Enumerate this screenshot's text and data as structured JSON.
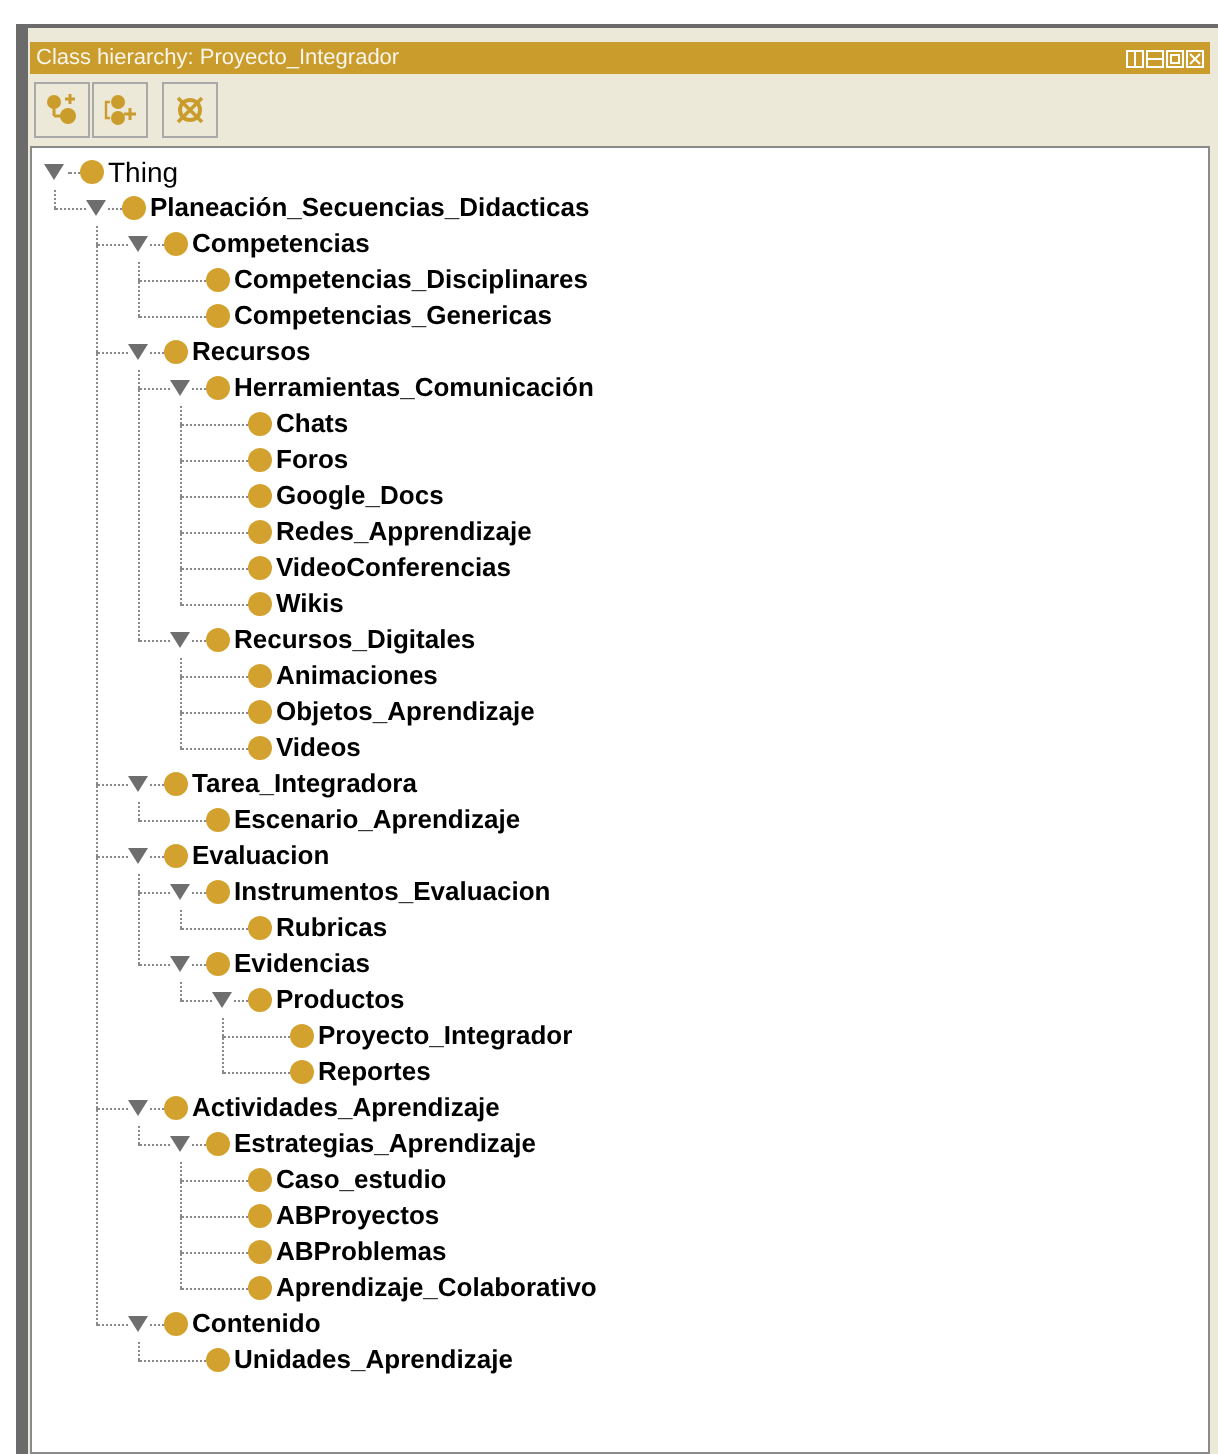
{
  "panel": {
    "title": "Class hierarchy: Proyecto_Integrador"
  },
  "tree": [
    {
      "label": "Thing",
      "bold": false,
      "expanded": true,
      "children": [
        {
          "label": "Planeación_Secuencias_Didacticas",
          "bold": true,
          "expanded": true,
          "children": [
            {
              "label": "Competencias",
              "bold": true,
              "expanded": true,
              "children": [
                {
                  "label": "Competencias_Disciplinares",
                  "bold": true
                },
                {
                  "label": "Competencias_Genericas",
                  "bold": true
                }
              ]
            },
            {
              "label": "Recursos",
              "bold": true,
              "expanded": true,
              "children": [
                {
                  "label": "Herramientas_Comunicación",
                  "bold": true,
                  "expanded": true,
                  "children": [
                    {
                      "label": "Chats",
                      "bold": true
                    },
                    {
                      "label": "Foros",
                      "bold": true
                    },
                    {
                      "label": "Google_Docs",
                      "bold": true
                    },
                    {
                      "label": "Redes_Apprendizaje",
                      "bold": true
                    },
                    {
                      "label": "VideoConferencias",
                      "bold": true
                    },
                    {
                      "label": "Wikis",
                      "bold": true
                    }
                  ]
                },
                {
                  "label": "Recursos_Digitales",
                  "bold": true,
                  "expanded": true,
                  "children": [
                    {
                      "label": "Animaciones",
                      "bold": true
                    },
                    {
                      "label": "Objetos_Aprendizaje",
                      "bold": true
                    },
                    {
                      "label": "Videos",
                      "bold": true
                    }
                  ]
                }
              ]
            },
            {
              "label": "Tarea_Integradora",
              "bold": true,
              "expanded": true,
              "children": [
                {
                  "label": "Escenario_Aprendizaje",
                  "bold": true
                }
              ]
            },
            {
              "label": "Evaluacion",
              "bold": true,
              "expanded": true,
              "children": [
                {
                  "label": "Instrumentos_Evaluacion",
                  "bold": true,
                  "expanded": true,
                  "children": [
                    {
                      "label": "Rubricas",
                      "bold": true
                    }
                  ]
                },
                {
                  "label": "Evidencias",
                  "bold": true,
                  "expanded": true,
                  "children": [
                    {
                      "label": "Productos",
                      "bold": true,
                      "expanded": true,
                      "children": [
                        {
                          "label": "Proyecto_Integrador",
                          "bold": true
                        },
                        {
                          "label": "Reportes",
                          "bold": true
                        }
                      ]
                    }
                  ]
                }
              ]
            },
            {
              "label": "Actividades_Aprendizaje",
              "bold": true,
              "expanded": true,
              "children": [
                {
                  "label": "Estrategias_Aprendizaje",
                  "bold": true,
                  "expanded": true,
                  "children": [
                    {
                      "label": "Caso_estudio",
                      "bold": true
                    },
                    {
                      "label": "ABProyectos",
                      "bold": true
                    },
                    {
                      "label": "ABProblemas",
                      "bold": true
                    },
                    {
                      "label": "Aprendizaje_Colaborativo",
                      "bold": true
                    }
                  ]
                }
              ]
            },
            {
              "label": "Contenido",
              "bold": true,
              "expanded": true,
              "children": [
                {
                  "label": "Unidades_Aprendizaje",
                  "bold": true
                }
              ]
            }
          ]
        }
      ]
    }
  ]
}
